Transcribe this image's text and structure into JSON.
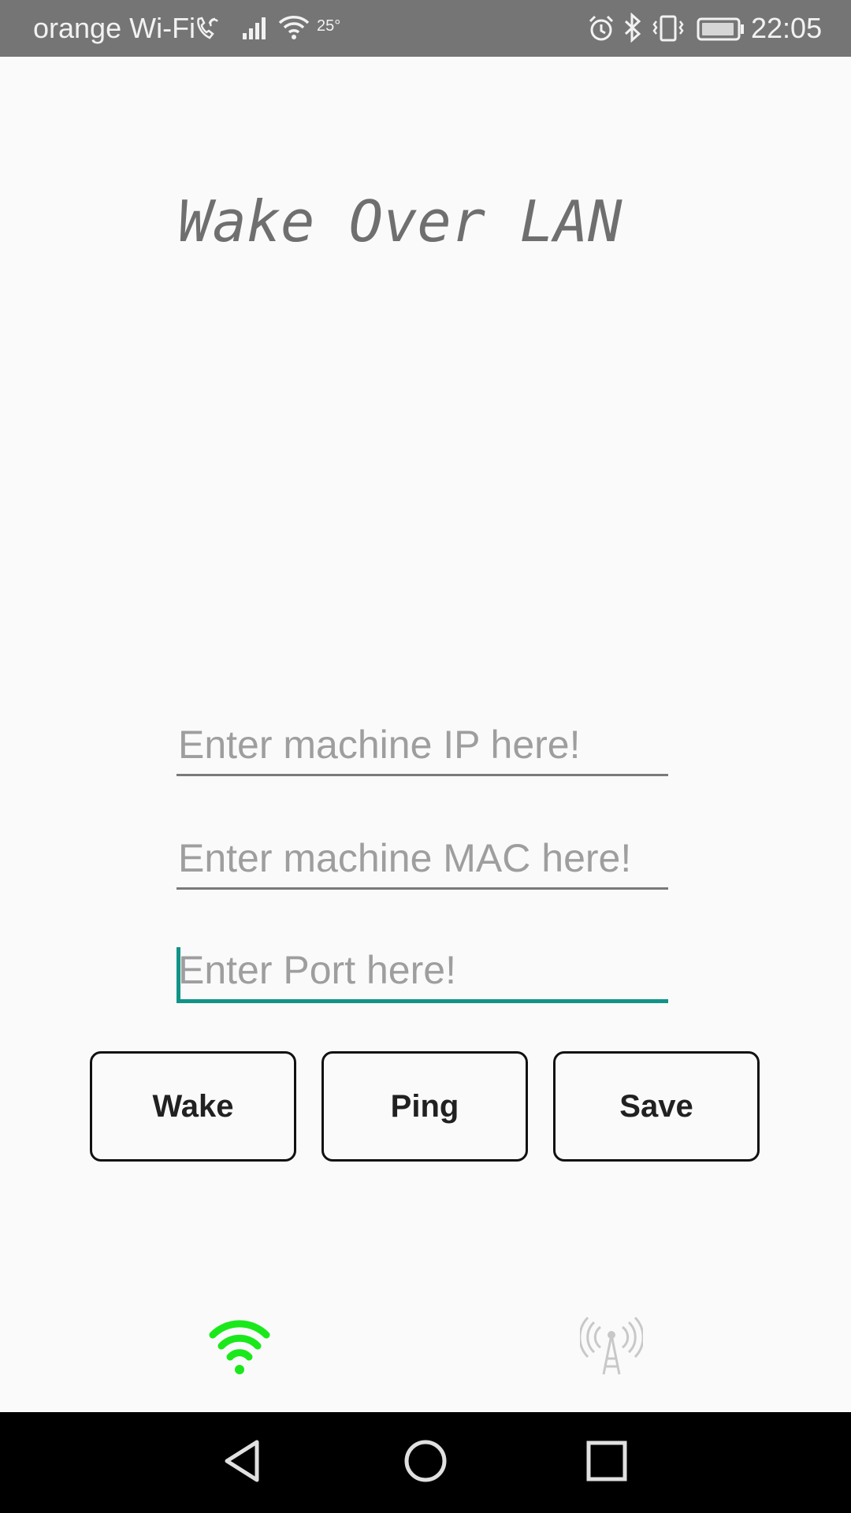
{
  "status_bar": {
    "carrier": "orange Wi-Fi",
    "temperature": "25°",
    "time": "22:05",
    "icons": [
      "wifi-calling-icon",
      "signal-icon",
      "wifi-icon",
      "alarm-icon",
      "bluetooth-icon",
      "vibrate-icon",
      "battery-icon"
    ]
  },
  "app": {
    "title": "Wake Over LAN"
  },
  "form": {
    "ip": {
      "value": "",
      "placeholder": "Enter machine IP here!"
    },
    "mac": {
      "value": "",
      "placeholder": "Enter machine MAC here!"
    },
    "port": {
      "value": "",
      "placeholder": "Enter Port here!"
    }
  },
  "buttons": {
    "wake": "Wake",
    "ping": "Ping",
    "save": "Save"
  },
  "indicators": {
    "wifi_icon": "wifi-icon",
    "wifi_color": "#1be81b",
    "antenna_icon": "antenna-icon",
    "antenna_color": "#c8c8c8"
  },
  "colors": {
    "accent": "#119387",
    "status_bar": "#757575"
  }
}
